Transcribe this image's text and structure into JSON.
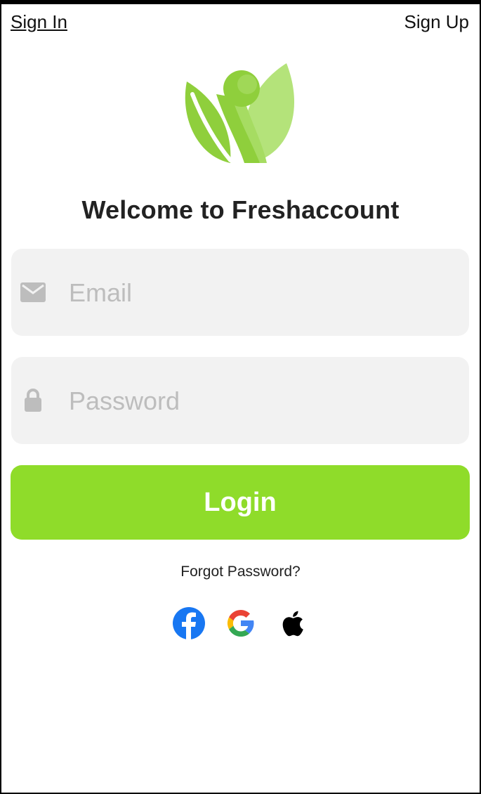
{
  "nav": {
    "sign_in": "Sign In",
    "sign_up": "Sign Up"
  },
  "title": "Welcome to Freshaccount",
  "form": {
    "email_placeholder": "Email",
    "email_value": "",
    "password_placeholder": "Password",
    "password_value": "",
    "login_label": "Login",
    "forgot_label": "Forgot Password?"
  },
  "social": [
    "facebook-icon",
    "google-icon",
    "apple-icon"
  ],
  "colors": {
    "accent": "#8fdc2a",
    "logo_green_dark": "#8fcf3c",
    "logo_green_light": "#b4e37a",
    "field_bg": "#f2f2f2",
    "facebook": "#1877f2"
  }
}
